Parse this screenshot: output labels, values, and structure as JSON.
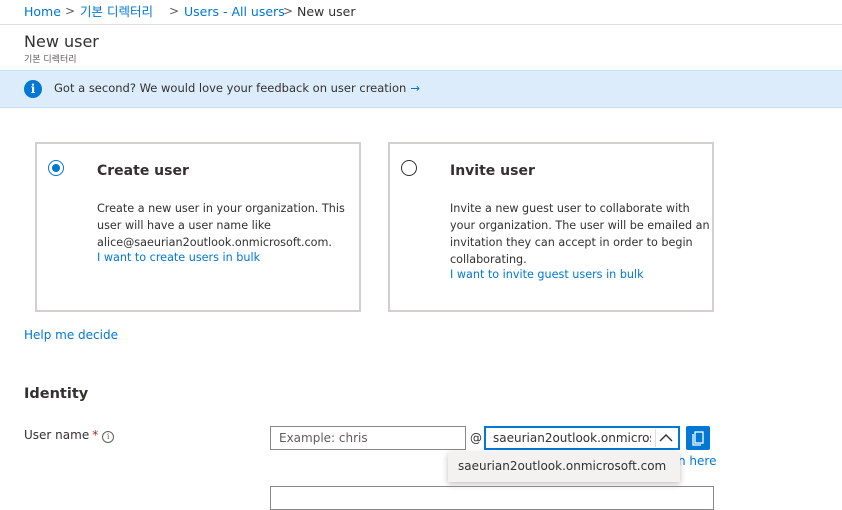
{
  "breadcrumb": {
    "items": [
      "Home",
      "기본 디렉터리",
      "Users - All users",
      "New user"
    ],
    "separator": ">"
  },
  "page": {
    "title": "New user",
    "subtitle": "기본 디렉터리"
  },
  "banner": {
    "icon": "info-icon",
    "text": "Got a second? We would love your feedback on user creation",
    "arrow": "→"
  },
  "options": [
    {
      "title": "Create user",
      "selected": true,
      "description": "Create a new user in your organization. This user will have a user name like alice@saeurian2outlook.onmicrosoft.com.",
      "link": "I want to create users in bulk"
    },
    {
      "title": "Invite user",
      "selected": false,
      "description": "Invite a new guest user to collaborate with your organization. The user will be emailed an invitation they can accept in order to begin collaborating.",
      "link": "I want to invite guest users in bulk"
    }
  ],
  "help_link": "Help me decide",
  "identity": {
    "section_title": "Identity",
    "username_label": "User name",
    "required_marker": "*",
    "info_glyph": "i",
    "username_placeholder": "Example: chris",
    "username_value": "",
    "at_symbol": "@",
    "domain_value": "saeurian2outlook.onmicrosoft.com",
    "domain_options": [
      "saeurian2outlook.onmicrosoft.com"
    ],
    "partial_link_text": "n here"
  },
  "colors": {
    "accent": "#0078d4",
    "banner_bg": "#dcecfb",
    "required": "#a4262c"
  }
}
